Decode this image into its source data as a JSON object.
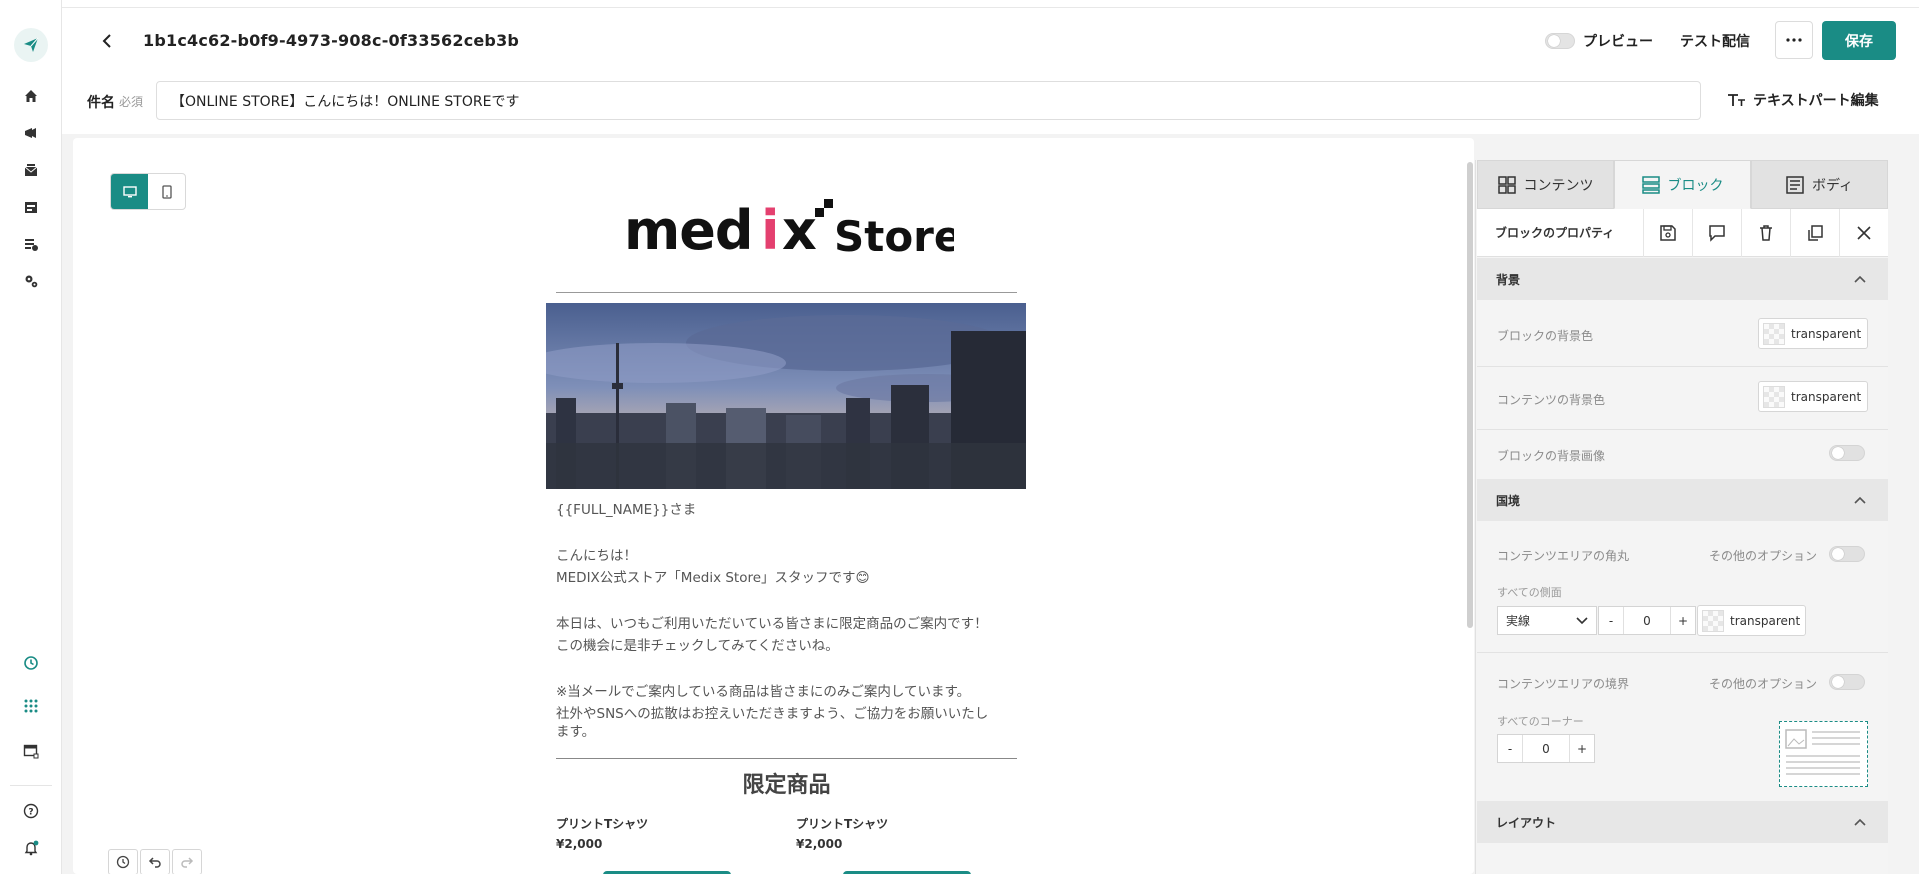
{
  "header": {
    "doc_id": "1b1c4c62-b0f9-4973-908c-0f33562ceb3b",
    "preview_label": "プレビュー",
    "test_send_label": "テスト配信",
    "more_label": "···",
    "save_label": "保存"
  },
  "subject": {
    "label": "件名",
    "required": "必須",
    "value": "【ONLINE STORE】こんにちは！ONLINE STOREです"
  },
  "text_edit_label": "テキストパート編集",
  "email": {
    "brand": "medix Store",
    "greeting_name": "{{FULL_NAME}}さま",
    "hello": "こんにちは！",
    "intro": "MEDIX公式ストア「Medix Store」スタッフです😊",
    "line1": "本日は、いつもご利用いただいている皆さまに限定商品のご案内です！",
    "line2": "この機会に是非チェックしてみてくださいね。",
    "note1": "※当メールでご案内している商品は皆さまにのみご案内しています。",
    "note2": "社外やSNSへの拡散はお控えいただきますよう、ご協力をお願いいたし",
    "note3": "ます。",
    "section_title": "限定商品",
    "products": [
      {
        "name": "プリントTシャツ",
        "price": "¥2,000"
      },
      {
        "name": "プリントTシャツ",
        "price": "¥2,000"
      }
    ]
  },
  "panel": {
    "tabs": [
      {
        "label": "コンテンツ",
        "icon": "grid-icon"
      },
      {
        "label": "ブロック",
        "icon": "block-icon"
      },
      {
        "label": "ボディ",
        "icon": "body-icon"
      }
    ],
    "props_label": "ブロックのプロパティ",
    "sections": {
      "background": "背景",
      "border": "国境",
      "layout": "レイアウト"
    },
    "rows": {
      "block_bg_color": "ブロックの背景色",
      "content_bg_color": "コンテンツの背景色",
      "block_bg_image": "ブロックの背景画像",
      "content_radius": "コンテンツエリアの角丸",
      "all_sides": "すべての側面",
      "content_border": "コンテンツエリアの境界",
      "all_corners": "すべてのコーナー"
    },
    "other_options": "その他のオプション",
    "color_value": "transparent",
    "border_style": "実線",
    "stepper_value": "0",
    "minus": "-",
    "plus": "+"
  },
  "colors": {
    "accent": "#1a8c85",
    "brand_pink": "#e4406f"
  }
}
